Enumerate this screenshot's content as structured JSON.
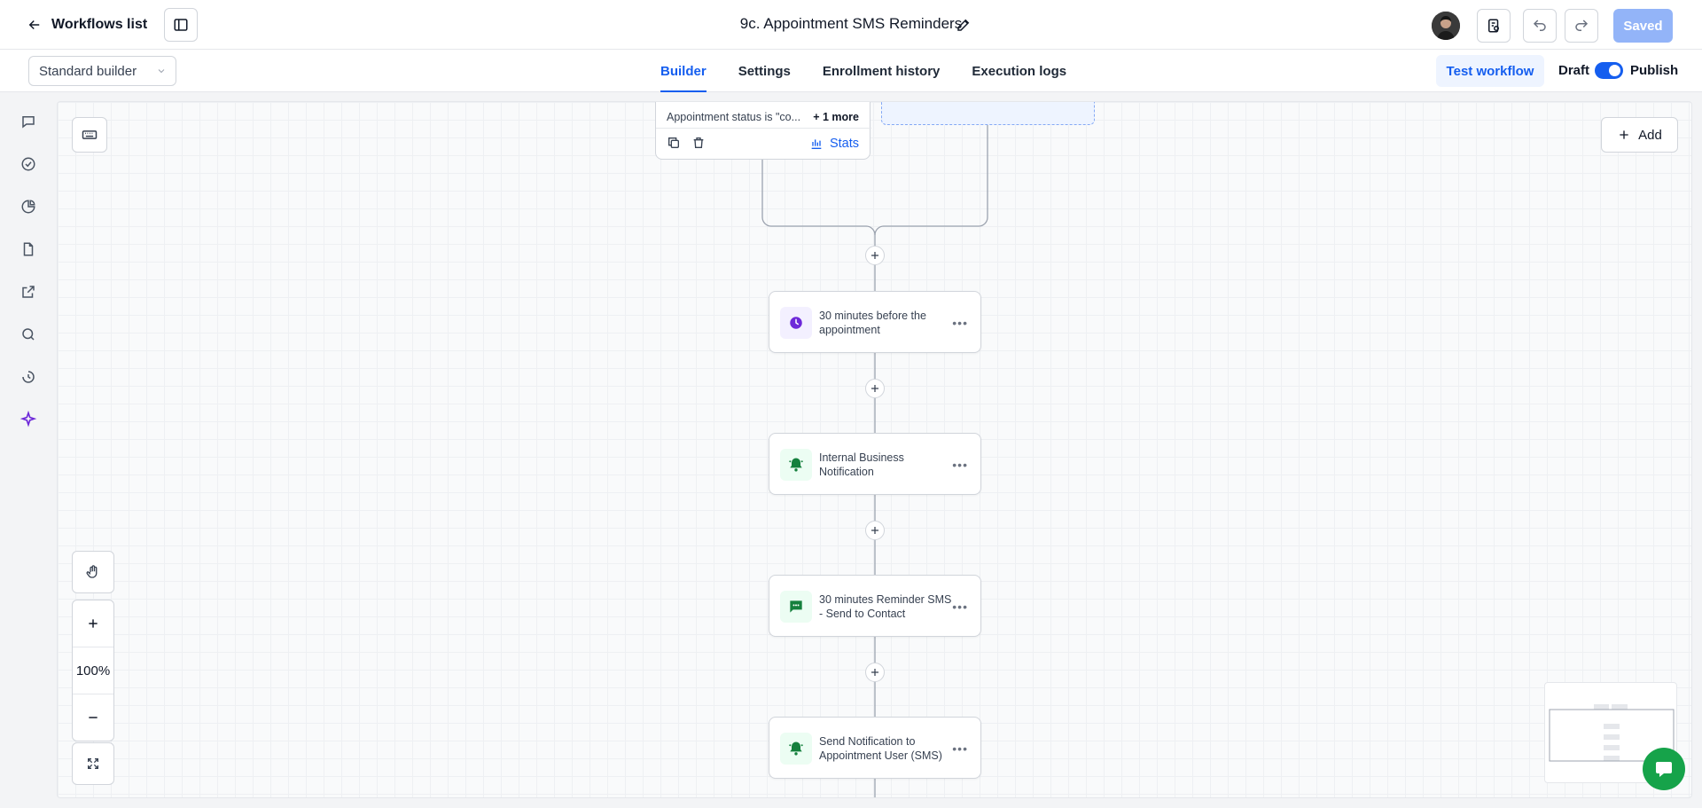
{
  "topbar": {
    "back_label": "Workflows list",
    "title": "9c. Appointment SMS Reminders",
    "saved_label": "Saved"
  },
  "subbar": {
    "builder_select": "Standard builder",
    "tabs": [
      {
        "label": "Builder"
      },
      {
        "label": "Settings"
      },
      {
        "label": "Enrollment history"
      },
      {
        "label": "Execution logs"
      }
    ],
    "test_label": "Test workflow",
    "draft_label": "Draft",
    "publish_label": "Publish"
  },
  "canvas": {
    "add_label": "Add",
    "zoom_label": "100%",
    "trigger": {
      "condition": "Appointment status is \"co...",
      "more": "+ 1 more",
      "stats_label": "Stats"
    },
    "nodes": [
      {
        "label": "30 minutes before the appointment",
        "icon": "clock-icon"
      },
      {
        "label": "Internal Business Notification",
        "icon": "bell-icon"
      },
      {
        "label": "30 minutes Reminder SMS - Send to Contact",
        "icon": "sms-icon"
      },
      {
        "label": "Send Notification to Appointment User (SMS)",
        "icon": "bell-icon"
      }
    ]
  },
  "colors": {
    "accent": "#155eef",
    "wait_icon": "#6d28d9",
    "action_icon": "#15803d"
  }
}
